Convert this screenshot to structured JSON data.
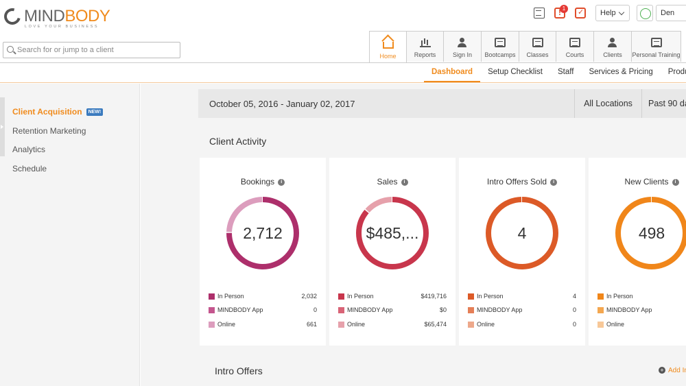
{
  "brand": {
    "name_part1": "MIND",
    "name_part2": "BODY",
    "tagline": "LOVE YOUR BUSINESS",
    "accent_color": "#f08b1d"
  },
  "header": {
    "notification_count": "1",
    "help_label": "Help",
    "user_label": "Den"
  },
  "search": {
    "placeholder": "Search for or jump to a client"
  },
  "module_tabs": [
    {
      "label": "Home",
      "icon": "home-icon",
      "active": true
    },
    {
      "label": "Reports",
      "icon": "bar-chart-icon"
    },
    {
      "label": "Sign In",
      "icon": "person-icon"
    },
    {
      "label": "Bootcamps",
      "icon": "calendar-icon"
    },
    {
      "label": "Classes",
      "icon": "calendar-icon"
    },
    {
      "label": "Courts",
      "icon": "calendar-icon"
    },
    {
      "label": "Clients",
      "icon": "person-icon"
    },
    {
      "label": "Personal Training",
      "icon": "calendar-icon"
    }
  ],
  "subnav": [
    "Dashboard",
    "Setup Checklist",
    "Staff",
    "Services & Pricing",
    "Produ"
  ],
  "sidebar": {
    "items": [
      {
        "label": "Client Acquisition",
        "active": true,
        "badge": "NEW!"
      },
      {
        "label": "Retention Marketing"
      },
      {
        "label": "Analytics"
      },
      {
        "label": "Schedule"
      }
    ]
  },
  "filters": {
    "date_range": "October 05, 2016 - January 02, 2017",
    "location": "All Locations",
    "period": "Past 90 da"
  },
  "client_activity": {
    "title": "Client Activity",
    "cards": [
      {
        "title": "Bookings",
        "value": "2,712",
        "colors": [
          "#ad2f6b",
          "#c4568e",
          "#dc9dbd"
        ],
        "legend": [
          {
            "name": "In Person",
            "value": "2,032"
          },
          {
            "name": "MINDBODY App",
            "value": "0"
          },
          {
            "name": "Online",
            "value": "661"
          }
        ]
      },
      {
        "title": "Sales",
        "value": "$485,...",
        "colors": [
          "#c8364c",
          "#d96477",
          "#e6a1ab"
        ],
        "legend": [
          {
            "name": "In Person",
            "value": "$419,716"
          },
          {
            "name": "MINDBODY App",
            "value": "$0"
          },
          {
            "name": "Online",
            "value": "$65,474"
          }
        ]
      },
      {
        "title": "Intro Offers Sold",
        "value": "4",
        "colors": [
          "#dc5a27",
          "#e57f57",
          "#eda88b"
        ],
        "legend": [
          {
            "name": "In Person",
            "value": "4"
          },
          {
            "name": "MINDBODY App",
            "value": "0"
          },
          {
            "name": "Online",
            "value": "0"
          }
        ]
      },
      {
        "title": "New Clients",
        "value": "498",
        "colors": [
          "#f0861a",
          "#f4a750",
          "#f7c898"
        ],
        "legend": [
          {
            "name": "In Person",
            "value": ""
          },
          {
            "name": "MINDBODY App",
            "value": ""
          },
          {
            "name": "Online",
            "value": ""
          }
        ]
      }
    ]
  },
  "intro_offers": {
    "title": "Intro Offers",
    "add_label": "Add In"
  }
}
